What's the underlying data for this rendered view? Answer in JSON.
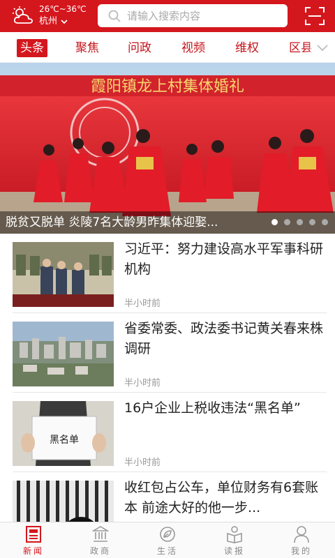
{
  "header": {
    "temperature": "26℃~36℃",
    "city": "杭州",
    "search_placeholder": "请输入搜索内容",
    "weather_icon": "cloud-sun-icon",
    "scan_icon": "scan-icon"
  },
  "tabs": [
    {
      "label": "头条",
      "active": true
    },
    {
      "label": "聚焦"
    },
    {
      "label": "问政"
    },
    {
      "label": "视频"
    },
    {
      "label": "维权"
    },
    {
      "label": "区县"
    }
  ],
  "banner": {
    "caption": "脱贫又脱单 炎陵7名大龄男昨集体迎娶...",
    "banner_sign": "霞阳镇龙上村集体婚礼",
    "dots": 5,
    "active_dot": 0
  },
  "news": [
    {
      "title": "习近平：努力建设高水平军事科研机构",
      "time": "半小时前",
      "thumb": "military-meeting-photo"
    },
    {
      "title": "省委常委、政法委书记黄关春来株调研",
      "time": "半小时前",
      "thumb": "city-aerial-photo"
    },
    {
      "title": "16户企业上税收违法“黑名单”",
      "time": "半小时前",
      "thumb": "blacklist-sign-photo",
      "thumb_text": "黑名单"
    },
    {
      "title": "收红包占公车，单位财务有6套账本 前途大好的他一步...",
      "time": "",
      "thumb": "prison-bars-photo"
    }
  ],
  "bottom_nav": [
    {
      "label": "新闻",
      "icon": "newspaper-icon",
      "active": true
    },
    {
      "label": "政商",
      "icon": "building-icon"
    },
    {
      "label": "生活",
      "icon": "leaf-icon"
    },
    {
      "label": "读报",
      "icon": "book-icon"
    },
    {
      "label": "我的",
      "icon": "user-icon"
    }
  ],
  "colors": {
    "brand": "#d4161d",
    "text": "#222222",
    "muted": "#999999"
  }
}
